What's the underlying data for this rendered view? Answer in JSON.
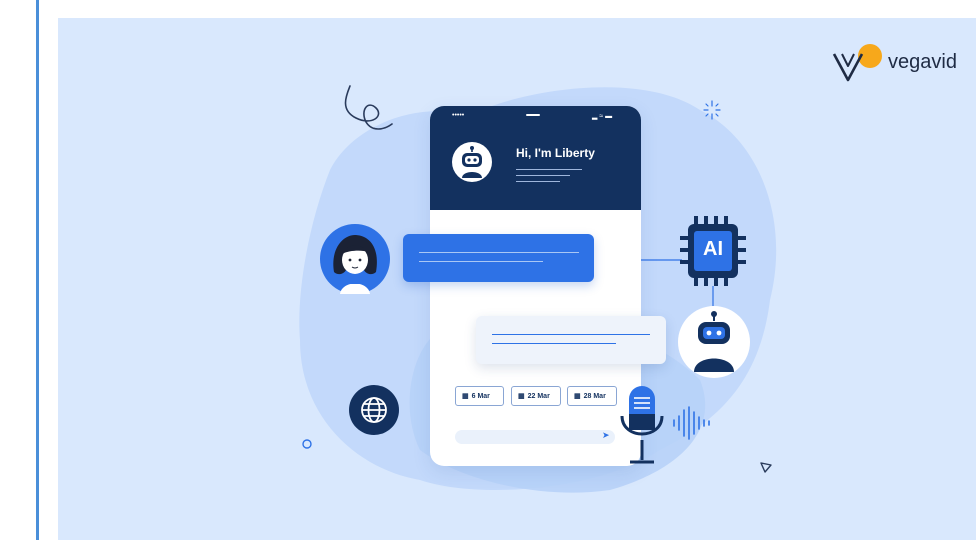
{
  "brand": {
    "name": "vegavid",
    "logo_icon": "v-logo-icon",
    "accent_color": "#f7a81b"
  },
  "phone": {
    "greeting": "Hi, I'm Liberty",
    "ai_chip_label": "AI",
    "dates": [
      "6 Mar",
      "22 Mar",
      "28 Mar"
    ]
  },
  "colors": {
    "navy": "#13315f",
    "blue": "#2e72e6",
    "bg": "#d9e8fd",
    "blob": "#c3d9fb"
  },
  "icons": [
    "robot-icon",
    "woman-avatar-icon",
    "ai-chip-icon",
    "globe-icon",
    "microphone-icon",
    "sound-wave-icon",
    "calendar-icon",
    "send-icon"
  ]
}
